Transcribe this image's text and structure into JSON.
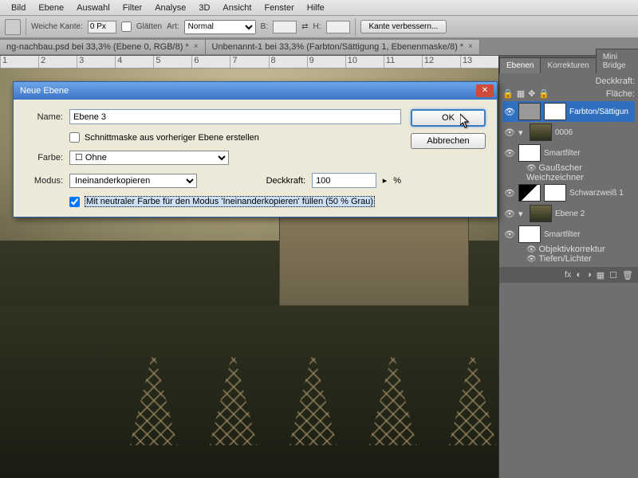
{
  "menu": [
    "Bild",
    "Ebene",
    "Auswahl",
    "Filter",
    "Analyse",
    "3D",
    "Ansicht",
    "Fenster",
    "Hilfe"
  ],
  "optbar": {
    "weiche_kante": "Weiche Kante:",
    "wk_val": "0 Px",
    "glaetten": "Glätten",
    "art": "Art:",
    "art_val": "Normal",
    "b": "B:",
    "h": "H:",
    "kante_btn": "Kante verbessern..."
  },
  "doctabs": [
    "ng-nachbau.psd bei 33,3% (Ebene 0, RGB/8) *",
    "Unbenannt-1 bei 33,3% (Farbton/Sättigung 1, Ebenenmaske/8) *"
  ],
  "ruler": [
    "1",
    "2",
    "3",
    "4",
    "5",
    "6",
    "7",
    "8",
    "9",
    "10",
    "11",
    "12",
    "13"
  ],
  "panels": {
    "tabs": [
      "Ebenen",
      "Korrekturen",
      "Mini Bridge"
    ],
    "deckkraft": "Deckkraft:",
    "flaeche": "Fläche:",
    "layers": {
      "l1": "Farbton/Sättigun",
      "l2": "0006",
      "sf": "Smartfilter",
      "gw": "Gaußscher Weichzeichner",
      "sw": "Schwarzweiß 1",
      "e2": "Ebene 2",
      "ok": "Objektivkorrektur",
      "tl": "Tiefen/Lichter"
    },
    "footer_icons": [
      "fx",
      "◐",
      "◑",
      "▦",
      "☐",
      "🗑"
    ]
  },
  "dialog": {
    "title": "Neue Ebene",
    "name_lbl": "Name:",
    "name_val": "Ebene 3",
    "clip": "Schnittmaske aus vorheriger Ebene erstellen",
    "farbe_lbl": "Farbe:",
    "farbe_val": "Ohne",
    "modus_lbl": "Modus:",
    "modus_val": "Ineinanderkopieren",
    "deck_lbl": "Deckkraft:",
    "deck_val": "100",
    "pct": "%",
    "neutral": "Mit neutraler Farbe für den Modus 'Ineinanderkopieren' füllen (50 % Grau)",
    "ok": "OK",
    "cancel": "Abbrechen"
  }
}
